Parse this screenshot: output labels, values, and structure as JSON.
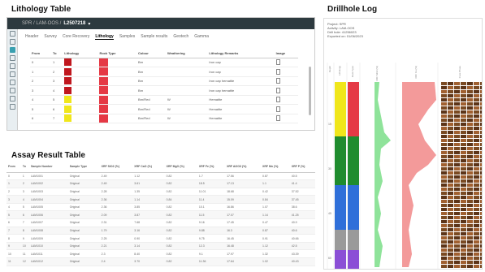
{
  "titles": {
    "lithology": "Lithology Table",
    "assay": "Assay Result Table",
    "drillhole": "Drillhole Log"
  },
  "topbar": {
    "project": "SPR / LAM-OOS /",
    "hole": "L2507218",
    "chev": "▾"
  },
  "tabs": [
    "Header",
    "Survey",
    "Core Recovery",
    "Lithology",
    "Samples",
    "Sample results",
    "Geotech",
    "Gamma"
  ],
  "active_tab": "Lithology",
  "lithology": {
    "headers": [
      "From",
      "To",
      "Lithology",
      "Rock Type",
      "Colour",
      "Weathering",
      "Lithology Remarks",
      "Image"
    ],
    "rows": [
      {
        "from": "0",
        "to": "1",
        "lith_color": "#c0171e",
        "rock_color": "#e53945",
        "colour": "Brn",
        "weath": "",
        "remarks": "Iron cap"
      },
      {
        "from": "1",
        "to": "2",
        "lith_color": "#c0171e",
        "rock_color": "#e53945",
        "colour": "Brn",
        "weath": "",
        "remarks": "Iron cap"
      },
      {
        "from": "2",
        "to": "3",
        "lith_color": "#c0171e",
        "rock_color": "#e53945",
        "colour": "Brn",
        "weath": "",
        "remarks": "Iron cap hematite"
      },
      {
        "from": "3",
        "to": "4",
        "lith_color": "#c0171e",
        "rock_color": "#e53945",
        "colour": "Brn",
        "weath": "",
        "remarks": "Iron cap hematite"
      },
      {
        "from": "4",
        "to": "5",
        "lith_color": "#f0e61b",
        "rock_color": "#e53945",
        "colour": "Brn/Red",
        "weath": "W",
        "remarks": "Hematite"
      },
      {
        "from": "5",
        "to": "6",
        "lith_color": "#f0e61b",
        "rock_color": "#e53945",
        "colour": "Brn/Red",
        "weath": "W",
        "remarks": "Hematite"
      },
      {
        "from": "6",
        "to": "7",
        "lith_color": "#f0e61b",
        "rock_color": "#e53945",
        "colour": "Brn/Red",
        "weath": "W",
        "remarks": "Hematite"
      }
    ]
  },
  "assay": {
    "headers": [
      "From",
      "To",
      "Sample Number",
      "Sample Type",
      "XRF SiO2 (%)",
      "XRF CaO (%)",
      "XRF MgO (%)",
      "XRF Fe (%)",
      "XRF Al2O3 (%)",
      "XRF Mn (%)",
      "XRF P (%)"
    ],
    "rows": [
      [
        "0",
        "1",
        "LAM1001",
        "Original",
        "2.49",
        "1.12",
        "0.82",
        "1.7",
        "17.56",
        "0.87",
        "40.5"
      ],
      [
        "1",
        "2",
        "LAM1002",
        "Original",
        "2.49",
        "3.61",
        "0.82",
        "18.5",
        "17.13",
        "1.1",
        "41.4"
      ],
      [
        "2",
        "3",
        "LAM1003",
        "Original",
        "2.28",
        "1.35",
        "0.82",
        "11.01",
        "18.68",
        "0.42",
        "37.52"
      ],
      [
        "3",
        "4",
        "LAM1004",
        "Original",
        "2.36",
        "1.14",
        "0.84",
        "11.4",
        "15.09",
        "0.84",
        "37.45"
      ],
      [
        "4",
        "5",
        "LAM1005",
        "Original",
        "2.36",
        "3.85",
        "0.82",
        "10.1",
        "16.86",
        "1.07",
        "38.6"
      ],
      [
        "5",
        "6",
        "LAM1006",
        "Original",
        "2.09",
        "3.87",
        "0.82",
        "11.5",
        "17.07",
        "1.14",
        "41.25"
      ],
      [
        "6",
        "7",
        "LAM1007",
        "Original",
        "2.31",
        "7.68",
        "0.82",
        "9.16",
        "17.45",
        "0.47",
        "40.9"
      ],
      [
        "7",
        "8",
        "LAM1008",
        "Original",
        "1.79",
        "3.16",
        "0.82",
        "9.88",
        "16.3",
        "0.87",
        "40.6"
      ],
      [
        "8",
        "9",
        "LAM1009",
        "Original",
        "2.25",
        "0.90",
        "0.82",
        "9.75",
        "16.45",
        "0.91",
        "40.66"
      ],
      [
        "9",
        "10",
        "LAM1010",
        "Original",
        "2.21",
        "3.14",
        "0.82",
        "12.3",
        "16.48",
        "1.12",
        "42.5"
      ],
      [
        "10",
        "11",
        "LAM1011",
        "Original",
        "2.3",
        "8.40",
        "0.82",
        "9.1",
        "17.97",
        "1.32",
        "43.39"
      ],
      [
        "11",
        "12",
        "LAM1012",
        "Original",
        "2.4",
        "3.70",
        "0.82",
        "11.36",
        "17.64",
        "1.02",
        "40.43"
      ]
    ]
  },
  "drillhole": {
    "meta": [
      "Project: SPR",
      "Activity: LAM-OOS",
      "Drill hole: 41256023",
      "Exported on: 01/06/2023"
    ],
    "columns": [
      "Depth",
      "Lithology",
      "Rock Type",
      "XRF SiO2 (%)",
      "XRF Fe (%)",
      "Core Photo"
    ],
    "depth_ticks": [
      "15",
      "30",
      "45",
      "60"
    ]
  }
}
